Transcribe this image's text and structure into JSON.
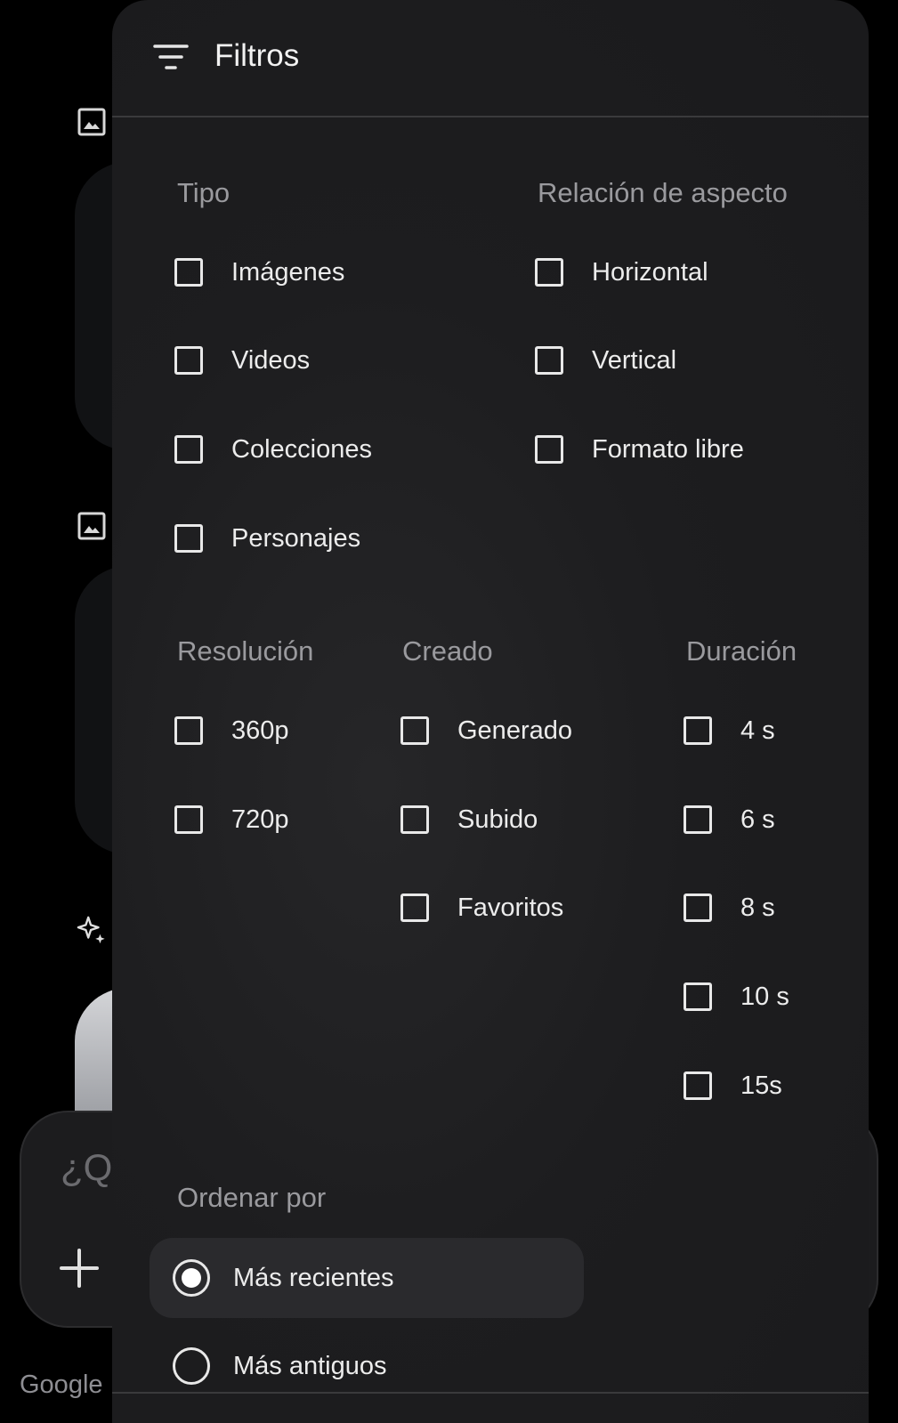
{
  "background": {
    "prompt_placeholder": "¿Qu",
    "brand": "Google"
  },
  "panel": {
    "title": "Filtros",
    "sections": {
      "tipo": {
        "label": "Tipo",
        "options": [
          "Imágenes",
          "Videos",
          "Colecciones",
          "Personajes"
        ]
      },
      "aspecto": {
        "label": "Relación de aspecto",
        "options": [
          "Horizontal",
          "Vertical",
          "Formato libre"
        ]
      },
      "resolucion": {
        "label": "Resolución",
        "options": [
          "360p",
          "720p"
        ]
      },
      "creado": {
        "label": "Creado",
        "options": [
          "Generado",
          "Subido",
          "Favoritos"
        ]
      },
      "duracion": {
        "label": "Duración",
        "options": [
          "4 s",
          "6 s",
          "8 s",
          "10 s",
          "15s"
        ]
      }
    },
    "sort": {
      "label": "Ordenar por",
      "options": [
        "Más recientes",
        "Más antiguos"
      ],
      "selected": "Más recientes"
    }
  },
  "colors": {
    "panel_bg": "#1d1d1f",
    "page_bg": "#000000",
    "text_primary": "#ececec",
    "text_secondary": "#9a9a9e",
    "divider": "#3a3a3c",
    "selected_row": "#2a2a2d"
  }
}
